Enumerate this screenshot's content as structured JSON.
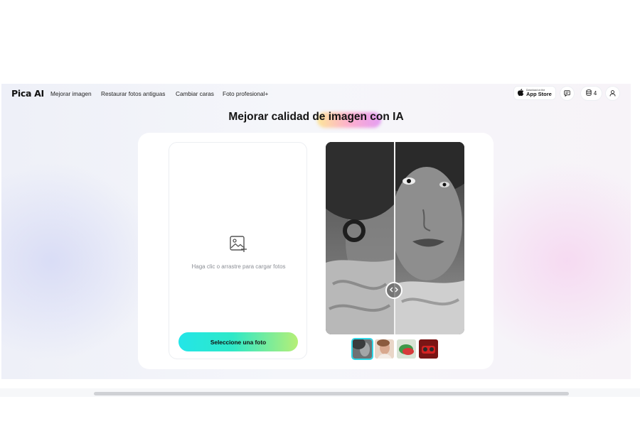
{
  "header": {
    "logo": "Pica AI",
    "nav": [
      {
        "label": "Mejorar imagen"
      },
      {
        "label": "Restaurar fotos antiguas"
      },
      {
        "label": "Cambiar caras"
      },
      {
        "label": "Foto profesional+"
      }
    ],
    "appstore": {
      "small": "Download on the",
      "big": "App Store"
    },
    "credits": "4",
    "icons": {
      "chat": "chat-icon",
      "credits": "coin-stack-icon",
      "user": "user-icon"
    }
  },
  "main": {
    "title": "Mejorar calidad de imagen con IA",
    "upload_hint": "Haga clic o arrastre para cargar fotos",
    "select_button": "Seleccione una foto"
  },
  "colors": {
    "button_gradient_start": "#23e6e8",
    "button_gradient_end": "#b6ef76",
    "thumb_active": "#2fd6e6"
  }
}
